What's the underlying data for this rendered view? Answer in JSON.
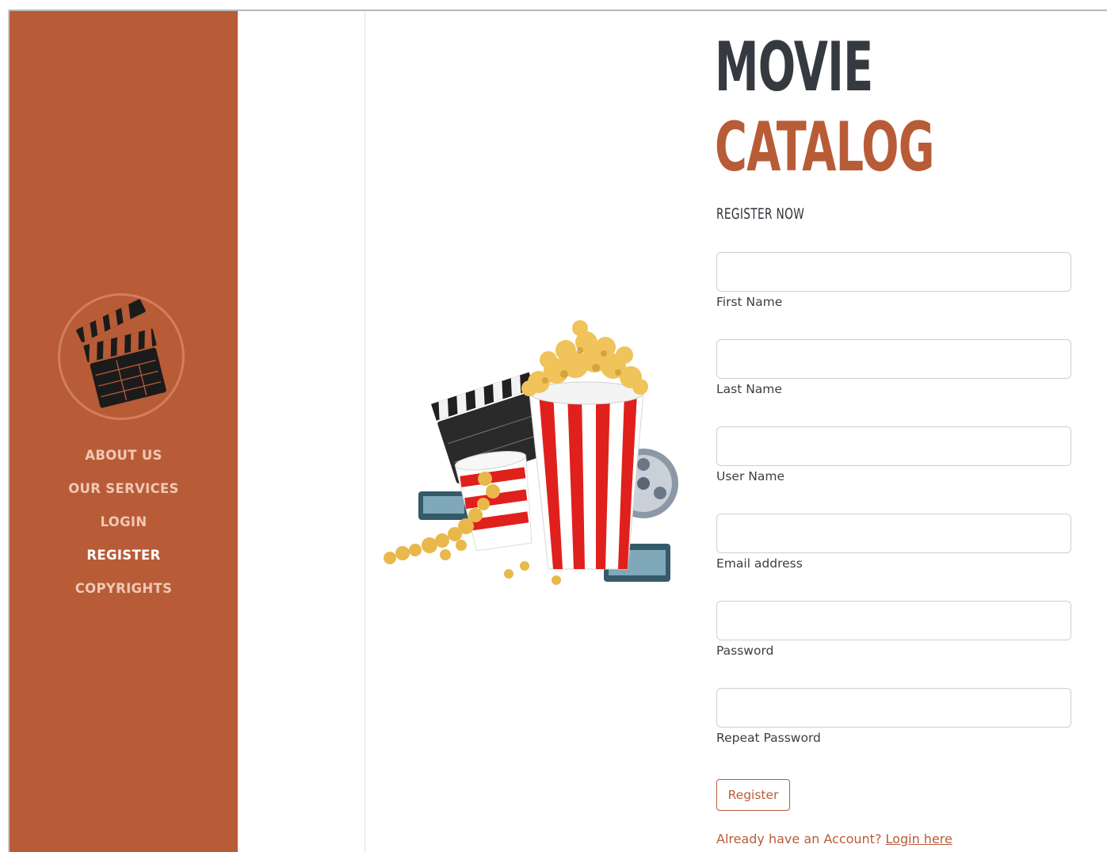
{
  "brand": {
    "title_line1": "MOVIE",
    "title_line2": "CATALOG",
    "subtitle": "REGISTER NOW",
    "accent_color": "#b85c37",
    "dark_color": "#343a40"
  },
  "sidebar": {
    "logo_icon": "clapperboard-icon",
    "items": [
      {
        "label": "ABOUT US",
        "active": false
      },
      {
        "label": "OUR SERVICES",
        "active": false
      },
      {
        "label": "LOGIN",
        "active": false
      },
      {
        "label": "REGISTER",
        "active": true
      },
      {
        "label": "COPYRIGHTS",
        "active": false
      }
    ]
  },
  "hero": {
    "icon": "popcorn-clapperboard-film-reel-illustration"
  },
  "form": {
    "fields": [
      {
        "label": "First Name",
        "value": "",
        "placeholder": ""
      },
      {
        "label": "Last Name",
        "value": "",
        "placeholder": ""
      },
      {
        "label": "User Name",
        "value": "",
        "placeholder": ""
      },
      {
        "label": "Email address",
        "value": "",
        "placeholder": ""
      },
      {
        "label": "Password",
        "value": "",
        "placeholder": ""
      },
      {
        "label": "Repeat Password",
        "value": "",
        "placeholder": ""
      }
    ],
    "submit_label": "Register",
    "login_prompt": "Already have an Account?",
    "login_link": "Login here"
  }
}
